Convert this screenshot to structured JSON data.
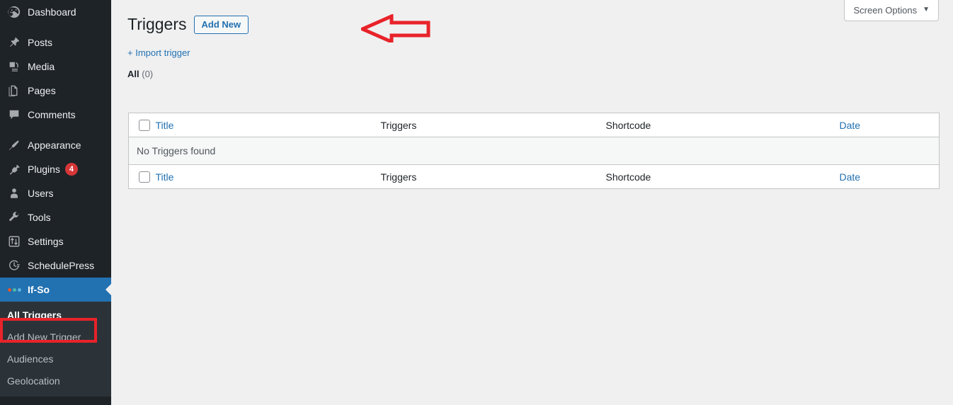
{
  "sidebar": {
    "items": [
      {
        "label": "Dashboard",
        "icon": "dashboard-icon",
        "badge": null
      },
      {
        "separator": true
      },
      {
        "label": "Posts",
        "icon": "pin-icon",
        "badge": null
      },
      {
        "label": "Media",
        "icon": "media-icon",
        "badge": null
      },
      {
        "label": "Pages",
        "icon": "pages-icon",
        "badge": null
      },
      {
        "label": "Comments",
        "icon": "comments-icon",
        "badge": null
      },
      {
        "separator": true
      },
      {
        "label": "Appearance",
        "icon": "paintbrush-icon",
        "badge": null
      },
      {
        "label": "Plugins",
        "icon": "plug-icon",
        "badge": "4"
      },
      {
        "label": "Users",
        "icon": "user-icon",
        "badge": null
      },
      {
        "label": "Tools",
        "icon": "wrench-icon",
        "badge": null
      },
      {
        "label": "Settings",
        "icon": "sliders-icon",
        "badge": null
      },
      {
        "label": "SchedulePress",
        "icon": "clock-icon",
        "badge": null
      },
      {
        "label": "If-So",
        "icon": "three-dots-icon",
        "badge": null,
        "active": true
      }
    ],
    "submenu": [
      {
        "label": "All Triggers",
        "current": true,
        "highlighted": true
      },
      {
        "label": "Add New Trigger",
        "current": false
      },
      {
        "label": "Audiences",
        "current": false
      },
      {
        "label": "Geolocation",
        "current": false
      }
    ]
  },
  "header": {
    "screen_options_label": "Screen Options",
    "screen_options_caret": "▼"
  },
  "main": {
    "page_title": "Triggers",
    "add_new_label": "Add New",
    "import_trigger_label": "+ Import trigger",
    "filter_all_label": "All",
    "filter_all_count": "(0)"
  },
  "table": {
    "columns": {
      "title": "Title",
      "triggers": "Triggers",
      "shortcode": "Shortcode",
      "date": "Date"
    },
    "empty_message": "No Triggers found"
  },
  "annotations": {
    "arrow_color": "#e8232a",
    "highlight_color": "#e8232a"
  },
  "colors": {
    "sidebar_bg": "#1d2327",
    "submenu_bg": "#2c3338",
    "accent_blue": "#2271b1",
    "page_bg": "#f0f0f1",
    "badge_red": "#d63638"
  }
}
